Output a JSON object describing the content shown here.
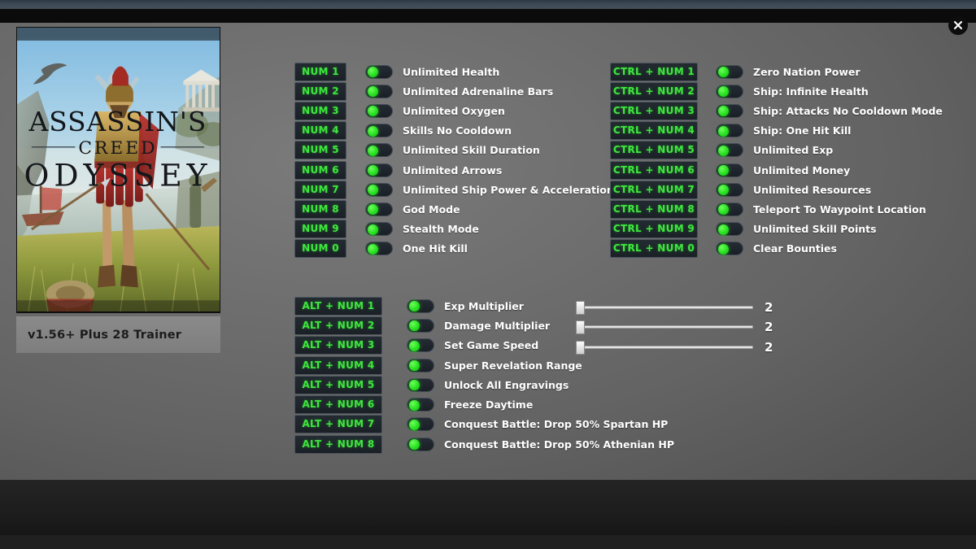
{
  "window": {
    "close_label": "×",
    "close_icon": "close-icon"
  },
  "game": {
    "cover_title_line1": "ASSASSIN'S",
    "cover_title_line2": "CREED",
    "cover_title_line3": "ODYSSEY",
    "version_text": "v1.56+ Plus 28 Trainer"
  },
  "colors": {
    "hotkey_text": "#3ee63e",
    "toggle_on": "#28e021",
    "label_text": "#ffffff",
    "panel_bg": "#6e6e6e"
  },
  "columns": {
    "num": [
      {
        "hotkey": "NUM 1",
        "label": "Unlimited Health",
        "state": "on"
      },
      {
        "hotkey": "NUM 2",
        "label": "Unlimited  Adrenaline Bars",
        "state": "on"
      },
      {
        "hotkey": "NUM 3",
        "label": "Unlimited  Oxygen",
        "state": "on"
      },
      {
        "hotkey": "NUM 4",
        "label": "Skills No Cooldown",
        "state": "on"
      },
      {
        "hotkey": "NUM 5",
        "label": "Unlimited Skill Duration",
        "state": "on"
      },
      {
        "hotkey": "NUM 6",
        "label": "Unlimited Arrows",
        "state": "on"
      },
      {
        "hotkey": "NUM 7",
        "label": "Unlimited Ship Power & Acceleration",
        "state": "on"
      },
      {
        "hotkey": "NUM 8",
        "label": "God Mode",
        "state": "on"
      },
      {
        "hotkey": "NUM 9",
        "label": "Stealth Mode",
        "state": "on"
      },
      {
        "hotkey": "NUM 0",
        "label": "One Hit Kill",
        "state": "on"
      }
    ],
    "ctrl": [
      {
        "hotkey": "CTRL + NUM 1",
        "label": "Zero Nation Power",
        "state": "on"
      },
      {
        "hotkey": "CTRL + NUM 2",
        "label": "Ship: Infinite Health",
        "state": "on"
      },
      {
        "hotkey": "CTRL + NUM 3",
        "label": "Ship: Attacks No Cooldown Mode",
        "state": "on"
      },
      {
        "hotkey": "CTRL + NUM 4",
        "label": "Ship: One Hit Kill",
        "state": "on"
      },
      {
        "hotkey": "CTRL + NUM 5",
        "label": "Unlimited Exp",
        "state": "on"
      },
      {
        "hotkey": "CTRL + NUM 6",
        "label": "Unlimited Money",
        "state": "on"
      },
      {
        "hotkey": "CTRL + NUM 7",
        "label": "Unlimited Resources",
        "state": "on"
      },
      {
        "hotkey": "CTRL + NUM 8",
        "label": "Teleport To Waypoint Location",
        "state": "on"
      },
      {
        "hotkey": "CTRL + NUM 9",
        "label": "Unlimited Skill Points",
        "state": "on"
      },
      {
        "hotkey": "CTRL + NUM 0",
        "label": "Clear Bounties",
        "state": "on"
      }
    ],
    "alt": [
      {
        "hotkey": "ALT + NUM 1",
        "label": "Exp Multiplier",
        "state": "on"
      },
      {
        "hotkey": "ALT + NUM 2",
        "label": "Damage Multiplier",
        "state": "on"
      },
      {
        "hotkey": "ALT + NUM 3",
        "label": "Set Game Speed",
        "state": "on"
      },
      {
        "hotkey": "ALT + NUM 4",
        "label": "Super Revelation Range",
        "state": "on"
      },
      {
        "hotkey": "ALT + NUM 5",
        "label": "Unlock All Engravings",
        "state": "on"
      },
      {
        "hotkey": "ALT + NUM 6",
        "label": "Freeze Daytime",
        "state": "on"
      },
      {
        "hotkey": "ALT + NUM 7",
        "label": "Conquest Battle: Drop 50% Spartan HP",
        "state": "on"
      },
      {
        "hotkey": "ALT + NUM 8",
        "label": "Conquest Battle: Drop 50% Athenian HP",
        "state": "on"
      }
    ]
  },
  "sliders": [
    {
      "for": "Exp Multiplier",
      "value": "2",
      "position_pct": 0
    },
    {
      "for": "Damage Multiplier",
      "value": "2",
      "position_pct": 0
    },
    {
      "for": "Set Game Speed",
      "value": "2",
      "position_pct": 0
    }
  ]
}
